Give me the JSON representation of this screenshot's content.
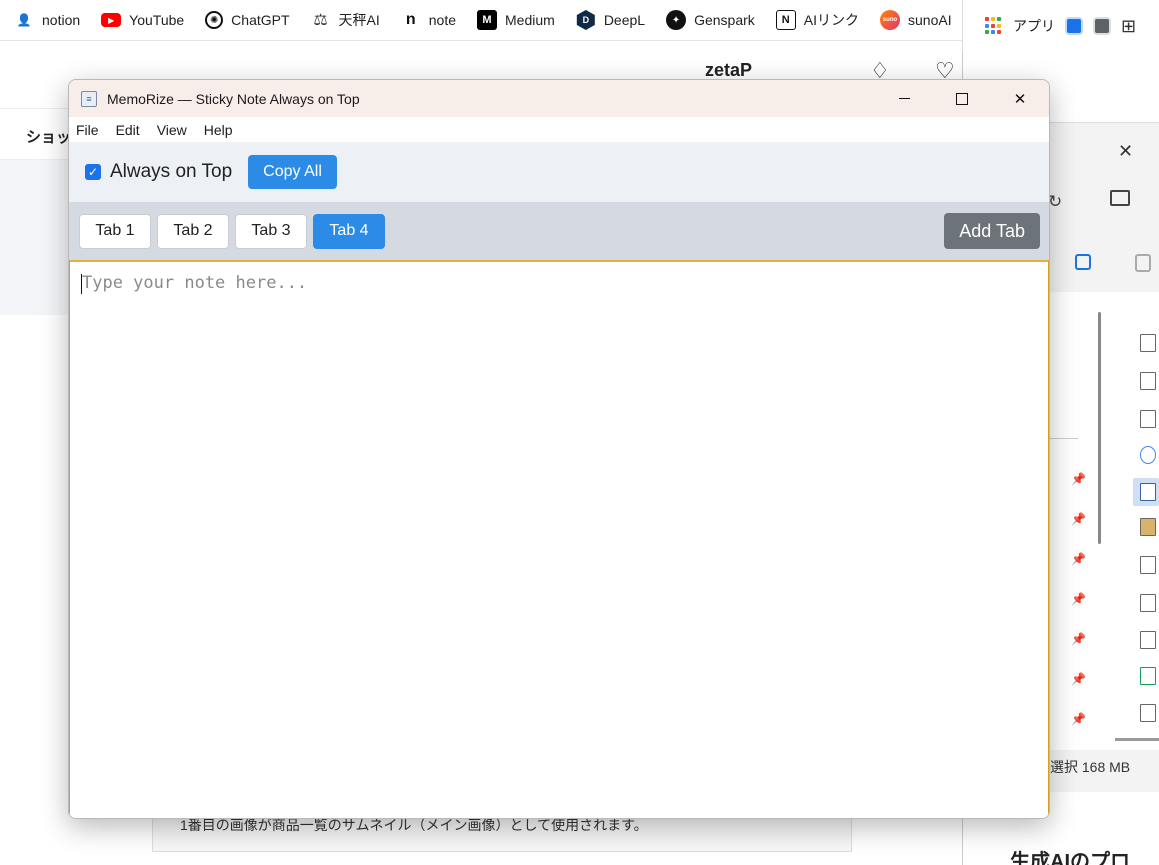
{
  "bookmarks": [
    {
      "label": "notion",
      "icon": "person-icon",
      "glyph": "👤"
    },
    {
      "label": "YouTube",
      "icon": "youtube-icon",
      "glyph": "▶"
    },
    {
      "label": "ChatGPT",
      "icon": "chatgpt-icon",
      "glyph": "✺"
    },
    {
      "label": "天秤AI",
      "icon": "scale-icon",
      "glyph": "⚖"
    },
    {
      "label": "note",
      "icon": "note-icon",
      "glyph": "n"
    },
    {
      "label": "Medium",
      "icon": "medium-icon",
      "glyph": "M"
    },
    {
      "label": "DeepL",
      "icon": "deepl-icon",
      "glyph": "D"
    },
    {
      "label": "Genspark",
      "icon": "genspark-icon",
      "glyph": "✦"
    },
    {
      "label": "AIリンク",
      "icon": "notion-icon",
      "glyph": "N"
    },
    {
      "label": "sunoAI",
      "icon": "suno-icon",
      "glyph": "suno"
    }
  ],
  "extension_bar": {
    "apps_label": "アプリ"
  },
  "background_page": {
    "user_name": "zetaP",
    "nav_label": "ショッ",
    "note_text": "1番目の画像が商品一覧のサムネイル（メイン画像）として使用されます。"
  },
  "explorer": {
    "status_text": "選択  168 MB",
    "bottom_heading": "生成AIのプロ"
  },
  "window": {
    "title": "MemoRize — Sticky Note Always on Top",
    "menu": [
      "File",
      "Edit",
      "View",
      "Help"
    ],
    "always_on_top_label": "Always on Top",
    "always_on_top_checked": true,
    "copy_all_label": "Copy All",
    "tabs": [
      {
        "label": "Tab 1",
        "active": false
      },
      {
        "label": "Tab 2",
        "active": false
      },
      {
        "label": "Tab 3",
        "active": false
      },
      {
        "label": "Tab 4",
        "active": true
      }
    ],
    "add_tab_label": "Add Tab",
    "note_placeholder": "Type your note here...",
    "note_value": ""
  },
  "colors": {
    "accent_blue": "#2b8be6",
    "add_tab_gray": "#6c7379",
    "titlebar_bg": "#f7ede9",
    "focus_border": "#e3b23c"
  }
}
